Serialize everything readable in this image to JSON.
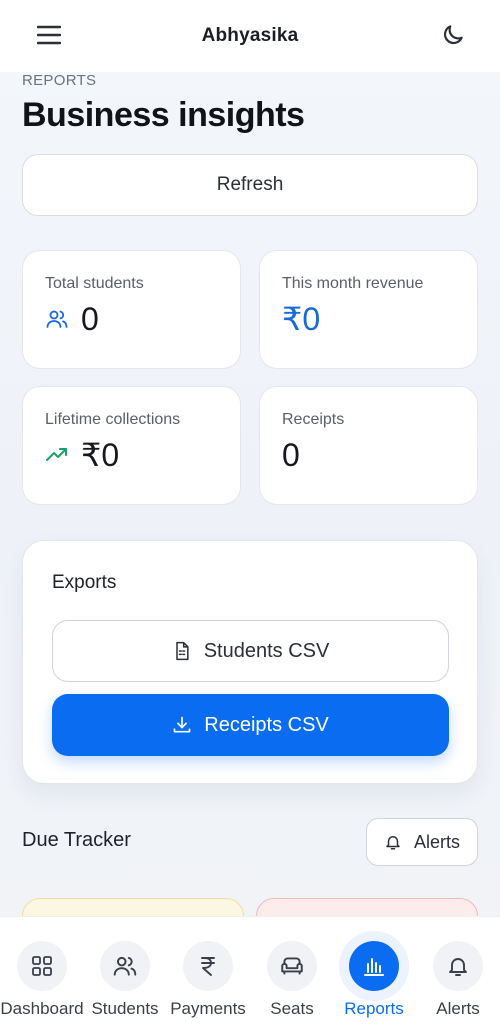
{
  "header": {
    "title": "Abhyasika",
    "menu_icon": "hamburger-menu-icon",
    "theme_icon": "moon-icon"
  },
  "page": {
    "eyebrow": "REPORTS",
    "title": "Business insights"
  },
  "refresh_label": "Refresh",
  "stats": [
    {
      "label": "Total students",
      "value": "0",
      "icon": "users-icon"
    },
    {
      "label": "This month revenue",
      "value": "₹0",
      "accent": "#1769e0"
    },
    {
      "label": "Lifetime collections",
      "value": "₹0",
      "icon": "trending-up-icon",
      "icon_color": "#16a36a"
    },
    {
      "label": "Receipts",
      "value": "0"
    }
  ],
  "exports": {
    "heading": "Exports",
    "students_csv": "Students CSV",
    "receipts_csv": "Receipts CSV"
  },
  "due_tracker": {
    "title": "Due Tracker",
    "alerts_label": "Alerts"
  },
  "nav": [
    {
      "label": "Dashboard",
      "icon": "dashboard-grid-icon"
    },
    {
      "label": "Students",
      "icon": "users-icon"
    },
    {
      "label": "Payments",
      "icon": "rupee-icon"
    },
    {
      "label": "Seats",
      "icon": "sofa-icon"
    },
    {
      "label": "Reports",
      "icon": "bar-chart-icon",
      "active": true
    },
    {
      "label": "Alerts",
      "icon": "bell-icon"
    }
  ],
  "colors": {
    "primary": "#0a6cf0",
    "background": "#f2f5fa",
    "accent_green": "#16a36a"
  }
}
